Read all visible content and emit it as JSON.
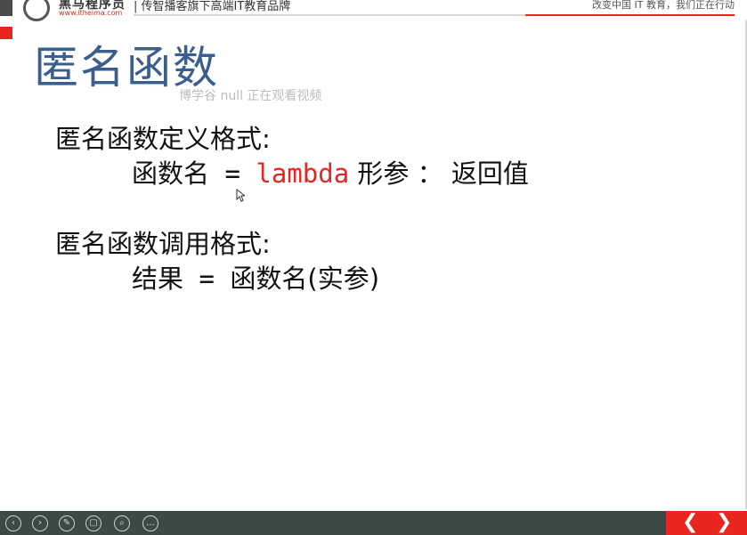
{
  "header": {
    "brand_name": "黑马程序员",
    "brand_url": "www.itheima.com",
    "tagline": "| 传智播客旗下高端IT教育品牌",
    "slogan": "改变中国 IT 教育，我们正在行动"
  },
  "slide": {
    "title": "匿名函数",
    "watermark": "博学谷 null 正在观看视频",
    "def_heading": "匿名函数定义格式:",
    "def_name": "函数名",
    "def_eq": " = ",
    "def_keyword": "lambda",
    "def_params": " 形参 ",
    "def_colon": "：",
    "def_return": " 返回值",
    "call_heading": "匿名函数调用格式:",
    "call_result": "结果",
    "call_eq": " = ",
    "call_expr": "函数名(实参)"
  },
  "toolbar": {
    "prev_icon": "‹",
    "next_icon": "›",
    "pen_icon": "✎",
    "slides_icon": "▢",
    "zoom_icon": "⌕",
    "more_icon": "…"
  },
  "nav": {
    "prev_label": "❮",
    "next_label": "❯"
  },
  "colors": {
    "title": "#3a5f8f",
    "keyword": "#e8261f",
    "accent": "#e8261f",
    "toolbar_bg": "#3c4a45"
  }
}
